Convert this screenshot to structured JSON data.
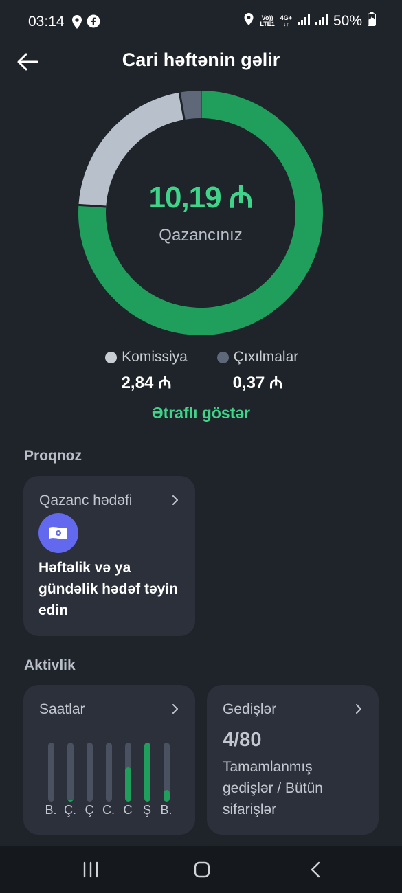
{
  "status": {
    "time": "03:14",
    "network_top": "Vo))",
    "network_bottom": "LTE1",
    "net_type": "4G+",
    "battery": "50%"
  },
  "header": {
    "title": "Cari həftənin gəlir"
  },
  "earnings": {
    "amount": "10,19 ₼",
    "label": "Qazancınız",
    "segments": [
      {
        "name": "Qazancınız",
        "value": 10.19,
        "color": "#1f9f5b"
      },
      {
        "name": "Komissiya",
        "value": 2.84,
        "color": "#b8c0cb"
      },
      {
        "name": "Çıxılmalar",
        "value": 0.37,
        "color": "#5e6878"
      }
    ]
  },
  "legend": {
    "commission_label": "Komissiya",
    "commission_value": "2,84 ₼",
    "deductions_label": "Çıxılmalar",
    "deductions_value": "0,37 ₼"
  },
  "more_link": "Ətraflı göstər",
  "forecast": {
    "section_title": "Proqnoz",
    "card_title": "Qazanc hədəfi",
    "card_text": "Həftəlik və ya gündəlik hədəf təyin edin"
  },
  "activity": {
    "section_title": "Aktivlik",
    "hours_title": "Saatlar",
    "days": [
      {
        "label": "B.",
        "level": 0
      },
      {
        "label": "Ç.",
        "level": 0.02
      },
      {
        "label": "Ç",
        "level": 0
      },
      {
        "label": "C.",
        "level": 0
      },
      {
        "label": "C",
        "level": 0.58
      },
      {
        "label": "Ş",
        "level": 1
      },
      {
        "label": "B.",
        "level": 0.2
      }
    ],
    "trips_title": "Gedişlər",
    "trips_value": "4/80",
    "trips_desc": "Tamamlanmış gedişlər / Bütün sifarişlər"
  }
}
